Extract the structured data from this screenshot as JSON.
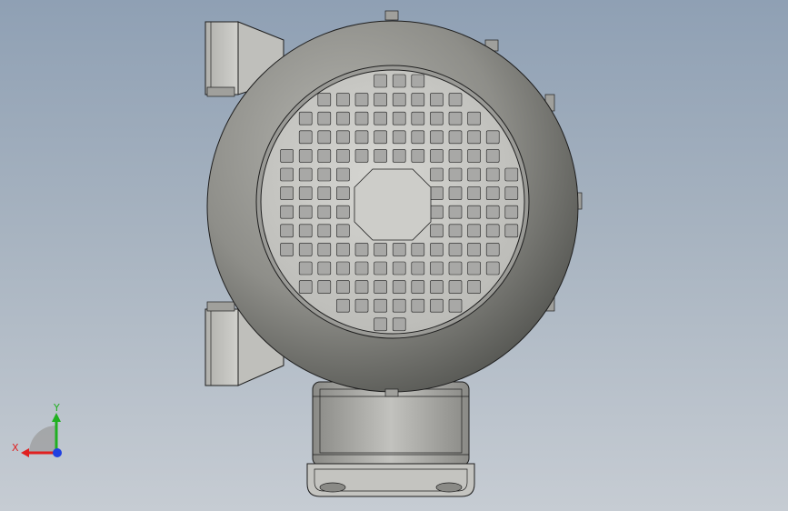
{
  "view": {
    "background_top": "#8fa0b4",
    "background_bottom": "#c6ccd3",
    "model_fill": "#9b9b96",
    "model_dark": "#5f605c",
    "grille_fill": "#c9c9c6",
    "slot_fill": "#a8a8a6",
    "edge_color": "#1e1e1e"
  },
  "triad": {
    "x_label": "X",
    "y_label": "Y",
    "x_color": "#e02020",
    "y_color": "#20b020",
    "z_color": "#2040e0"
  }
}
